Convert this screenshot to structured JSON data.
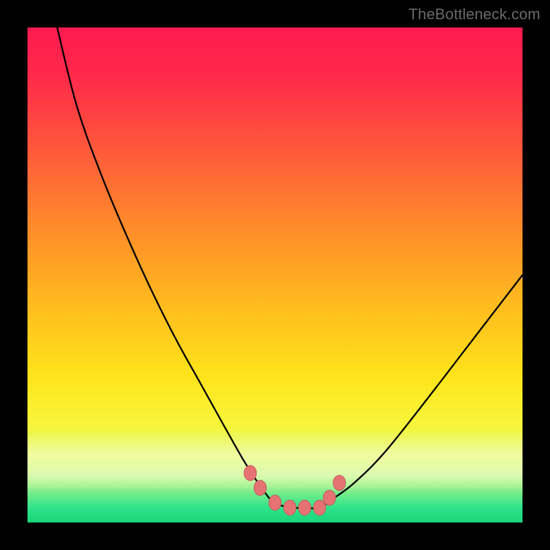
{
  "watermark": {
    "text": "TheBottleneck.com"
  },
  "colors": {
    "frame_bg": "#000000",
    "curve_stroke": "#000000",
    "marker_fill": "#e57373",
    "marker_stroke": "#c75a5a",
    "gradient_stops": [
      "#ff1a4f",
      "#ff2a4a",
      "#ff5a3a",
      "#ff8a2a",
      "#ffb81f",
      "#ffe31a",
      "#f8f53a",
      "#d9f85a",
      "#8ef08a",
      "#2fe38a",
      "#19d67a"
    ]
  },
  "chart_data": {
    "type": "line",
    "title": "",
    "xlabel": "",
    "ylabel": "",
    "xlim": [
      0,
      100
    ],
    "ylim": [
      0,
      100
    ],
    "note": "Single V-shaped bottleneck curve over a vertical red→green gradient. Y-axis is performance mismatch (100 = worst/red at top, 0 = best/green at bottom). X-axis is component balance (arbitrary 0–100). Minimum (y≈3) occurs across roughly x≈50–60; curve rises steeply to y=100 at x≈6 on the left and more gently to y≈50 at x=100 on the right.",
    "series": [
      {
        "name": "bottleneck-curve",
        "x": [
          6,
          10,
          15,
          20,
          25,
          30,
          35,
          40,
          44,
          48,
          50,
          53,
          56,
          59,
          62,
          66,
          72,
          80,
          90,
          100
        ],
        "y": [
          100,
          84,
          70,
          58,
          47,
          37,
          28,
          19,
          12,
          6,
          4,
          3,
          3,
          3,
          5,
          8,
          14,
          24,
          37,
          50
        ]
      }
    ],
    "markers": {
      "name": "optimum-markers",
      "x": [
        45,
        47,
        50,
        53,
        56,
        59,
        61,
        63
      ],
      "y": [
        10,
        7,
        4,
        3,
        3,
        3,
        5,
        8
      ]
    }
  }
}
